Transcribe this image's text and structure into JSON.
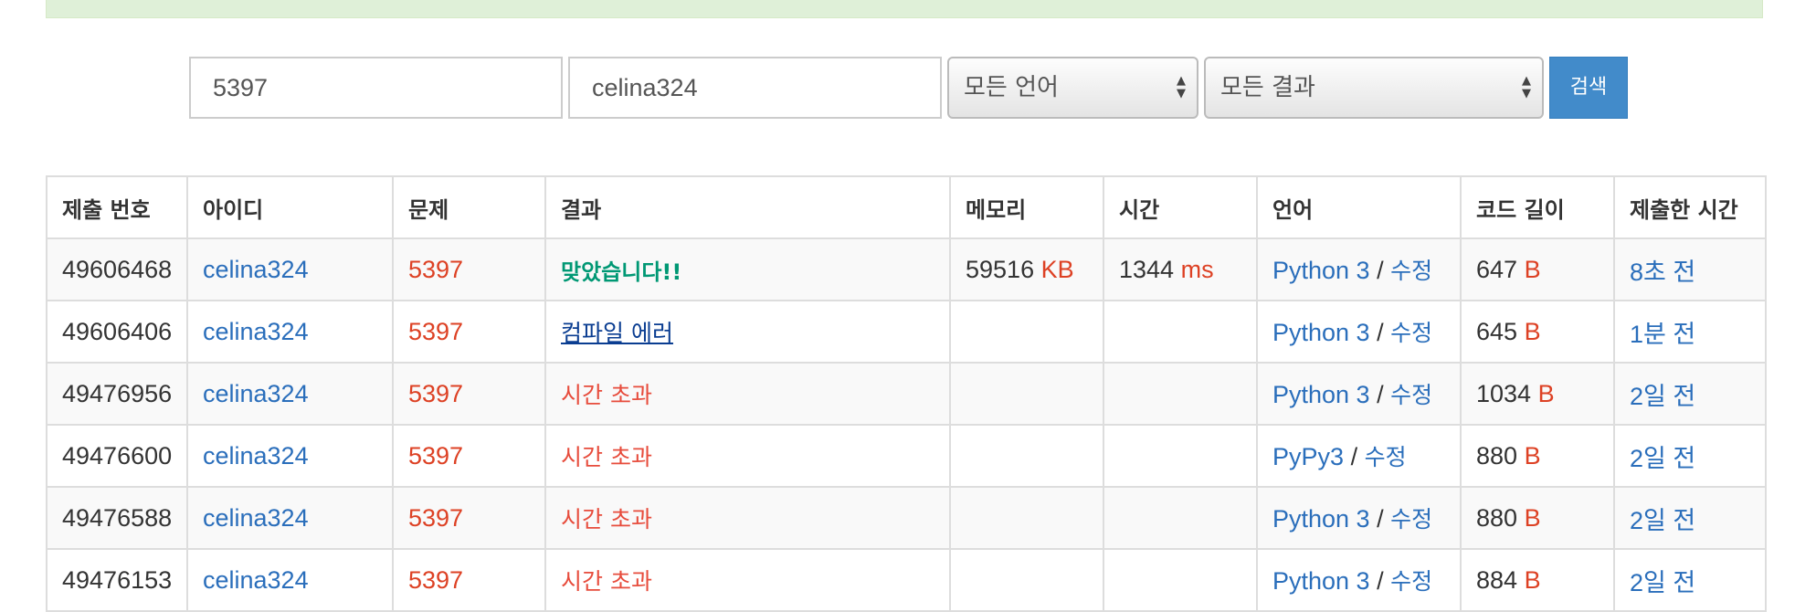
{
  "search": {
    "problem_value": "5397",
    "user_value": "celina324",
    "language_selected": "모든 언어",
    "result_selected": "모든 결과",
    "search_button": "검색"
  },
  "table": {
    "headers": [
      "제출 번호",
      "아이디",
      "문제",
      "결과",
      "메모리",
      "시간",
      "언어",
      "코드 길이",
      "제출한 시간"
    ],
    "units": {
      "memory": "KB",
      "time": "ms",
      "length": "B"
    },
    "edit_label": "수정",
    "lang_separator": "/",
    "rows": [
      {
        "id": "49606468",
        "user": "celina324",
        "problem": "5397",
        "result": "맞았습니다!!",
        "result_type": "ac",
        "memory": "59516",
        "time": "1344",
        "language": "Python 3",
        "length": "647",
        "submitted": "8초 전"
      },
      {
        "id": "49606406",
        "user": "celina324",
        "problem": "5397",
        "result": "컴파일 에러",
        "result_type": "ce",
        "memory": "",
        "time": "",
        "language": "Python 3",
        "length": "645",
        "submitted": "1분 전"
      },
      {
        "id": "49476956",
        "user": "celina324",
        "problem": "5397",
        "result": "시간 초과",
        "result_type": "tle",
        "memory": "",
        "time": "",
        "language": "Python 3",
        "length": "1034",
        "submitted": "2일 전"
      },
      {
        "id": "49476600",
        "user": "celina324",
        "problem": "5397",
        "result": "시간 초과",
        "result_type": "tle",
        "memory": "",
        "time": "",
        "language": "PyPy3",
        "length": "880",
        "submitted": "2일 전"
      },
      {
        "id": "49476588",
        "user": "celina324",
        "problem": "5397",
        "result": "시간 초과",
        "result_type": "tle",
        "memory": "",
        "time": "",
        "language": "Python 3",
        "length": "880",
        "submitted": "2일 전"
      },
      {
        "id": "49476153",
        "user": "celina324",
        "problem": "5397",
        "result": "시간 초과",
        "result_type": "tle",
        "memory": "",
        "time": "",
        "language": "Python 3",
        "length": "884",
        "submitted": "2일 전"
      }
    ]
  }
}
